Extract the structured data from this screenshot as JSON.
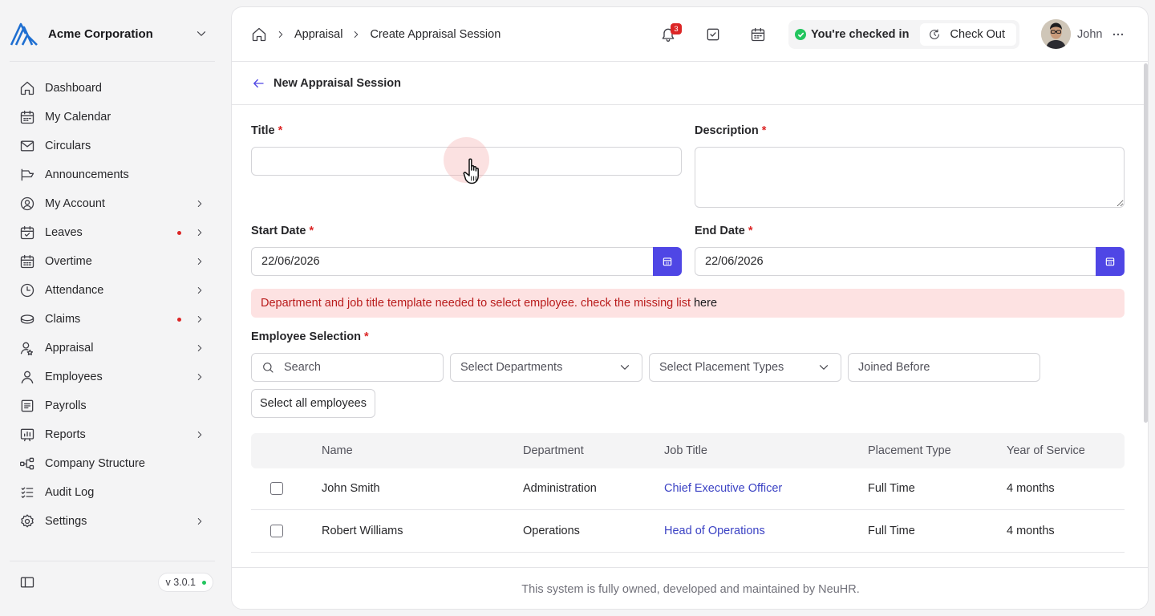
{
  "org": {
    "name": "Acme Corporation"
  },
  "sidebar": {
    "items": [
      {
        "label": "Dashboard",
        "icon": "home-icon",
        "chevron": false,
        "dot": false
      },
      {
        "label": "My Calendar",
        "icon": "calendar-icon",
        "chevron": false,
        "dot": false
      },
      {
        "label": "Circulars",
        "icon": "mail-icon",
        "chevron": false,
        "dot": false
      },
      {
        "label": "Announcements",
        "icon": "megaphone-icon",
        "chevron": false,
        "dot": false
      },
      {
        "label": "My Account",
        "icon": "user-circle-icon",
        "chevron": true,
        "dot": false
      },
      {
        "label": "Leaves",
        "icon": "calendar-check-icon",
        "chevron": true,
        "dot": true
      },
      {
        "label": "Overtime",
        "icon": "calendar-grid-icon",
        "chevron": true,
        "dot": false
      },
      {
        "label": "Attendance",
        "icon": "clock-icon",
        "chevron": true,
        "dot": false
      },
      {
        "label": "Claims",
        "icon": "coins-icon",
        "chevron": true,
        "dot": true
      },
      {
        "label": "Appraisal",
        "icon": "user-star-icon",
        "chevron": true,
        "dot": false
      },
      {
        "label": "Employees",
        "icon": "user-icon",
        "chevron": true,
        "dot": false
      },
      {
        "label": "Payrolls",
        "icon": "receipt-icon",
        "chevron": false,
        "dot": false
      },
      {
        "label": "Reports",
        "icon": "report-icon",
        "chevron": true,
        "dot": false
      },
      {
        "label": "Company Structure",
        "icon": "hierarchy-icon",
        "chevron": false,
        "dot": false
      },
      {
        "label": "Audit Log",
        "icon": "checklist-icon",
        "chevron": false,
        "dot": false
      },
      {
        "label": "Settings",
        "icon": "gear-icon",
        "chevron": true,
        "dot": false
      }
    ],
    "version": "v 3.0.1"
  },
  "header": {
    "breadcrumbs": [
      "Appraisal",
      "Create Appraisal Session"
    ],
    "notification_count": "3",
    "checkin_status": "You're checked in",
    "checkout_label": "Check Out",
    "user_name": "John"
  },
  "page": {
    "title": "New Appraisal Session",
    "form": {
      "title_label": "Title",
      "description_label": "Description",
      "start_date_label": "Start Date",
      "start_date_value": "22/06/2026",
      "end_date_label": "End Date",
      "end_date_value": "22/06/2026",
      "required_mark": "*"
    },
    "alert": {
      "text": "Department and job title template needed to select employee. check the missing list",
      "link": "here"
    },
    "employee_selection": {
      "label": "Employee Selection",
      "search_placeholder": "Search",
      "departments_placeholder": "Select Departments",
      "placement_placeholder": "Select Placement Types",
      "joined_before_placeholder": "Joined Before",
      "select_all_label": "Select all employees"
    },
    "table": {
      "columns": [
        "Name",
        "Department",
        "Job Title",
        "Placement Type",
        "Year of Service"
      ],
      "rows": [
        {
          "name": "John Smith",
          "department": "Administration",
          "job_title": "Chief Executive Officer",
          "placement": "Full Time",
          "service": "4 months"
        },
        {
          "name": "Robert Williams",
          "department": "Operations",
          "job_title": "Head of Operations",
          "placement": "Full Time",
          "service": "4 months"
        }
      ]
    },
    "footer": "This system is fully owned, developed and maintained by NeuHR."
  },
  "colors": {
    "accent": "#4f46e5",
    "danger": "#dc2626",
    "success": "#22c55e",
    "alert_bg": "#fde2e2",
    "link": "#3b42c4"
  }
}
